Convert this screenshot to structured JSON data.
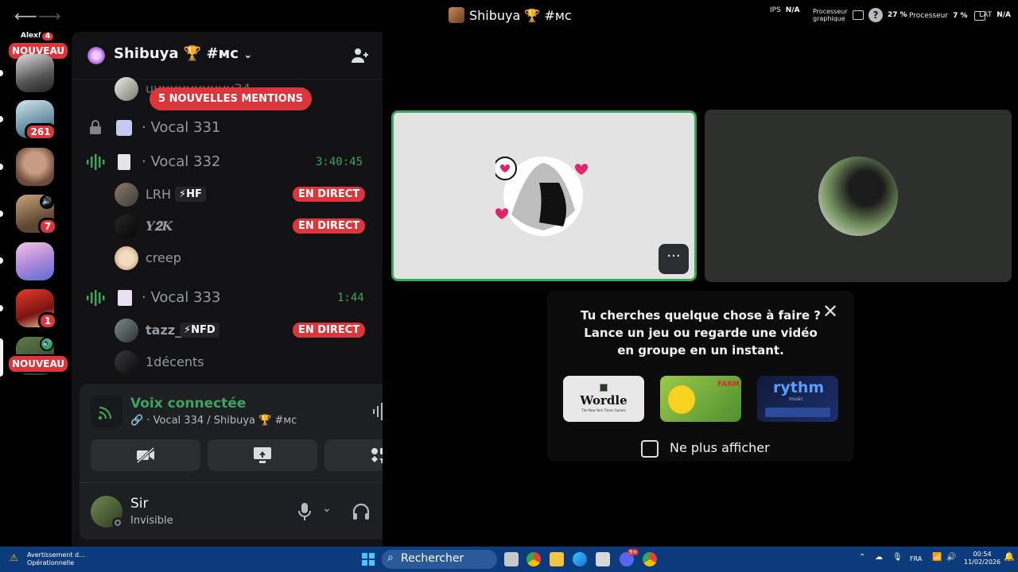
{
  "titlebar": {
    "title": "Shibuya 🏆 #ᴍᴄ",
    "hud": {
      "ips_label": "IPS",
      "ips_value": "N/A",
      "gpu_label_1": "Processeur",
      "gpu_label_2": "graphique",
      "gpu_value": "27 %",
      "cpu_label": "Processeur",
      "cpu_value": "7 %",
      "lat_label": "LAT",
      "lat_value": "N/A",
      "help": "?"
    }
  },
  "rail": {
    "top_user": "AlexF",
    "top_badge": "4",
    "nouveau_top": "NOUVEAU",
    "badge_261": "261",
    "badge_7": "7",
    "badge_1": "1",
    "nouveau_bottom": "NOUVEAU"
  },
  "server": {
    "name": "Shibuya 🏆 #ᴍᴄ",
    "mentions": "5 NOUVELLES MENTIONS",
    "partial_user": "uuuuuuuuuuu34",
    "channels": [
      {
        "name": "Vocal 331",
        "time": ""
      },
      {
        "name": "Vocal 332",
        "time": "3:40:45"
      },
      {
        "name": "Vocal 333",
        "time": "1:44"
      }
    ],
    "users_332": [
      {
        "name": "LRH",
        "tag": "⚡HF",
        "live": "EN DIRECT"
      },
      {
        "name": "𝒀𝟐𝑲",
        "tag": "",
        "live": "EN DIRECT"
      },
      {
        "name": "creep",
        "tag": "",
        "live": ""
      }
    ],
    "users_333": [
      {
        "name": "tazz_",
        "tag": "⚡NFD",
        "live": "EN DIRECT"
      },
      {
        "name": "1décents",
        "tag": "",
        "live": ""
      }
    ]
  },
  "voice": {
    "title": "Voix connectée",
    "sub": "Vocal 334 / Shibuya 🏆 #ᴍᴄ"
  },
  "me": {
    "name": "Sir",
    "status": "Invisible"
  },
  "activity": {
    "text": "Tu cherches quelque chose à faire ? Lance un jeu ou regarde une vidéo en groupe en un instant.",
    "card1": "Wordle",
    "card1_sub": "The New York Times Games",
    "card2_label": "FARM",
    "card3": "rythm",
    "card3_sub": "music",
    "checkbox": "Ne plus afficher"
  },
  "taskbar": {
    "warn_1": "Avertissement d...",
    "warn_2": "Opérationnelle",
    "search": "Rechercher",
    "lang": "FRA",
    "time": "00:54",
    "date": "11/02/2026",
    "discord_badge": "9+"
  },
  "colors": {
    "live_red": "#da373c",
    "voice_green": "#3ba55c",
    "sidebar_bg": "#121214",
    "taskbar_blue": "#0b3b7a"
  }
}
